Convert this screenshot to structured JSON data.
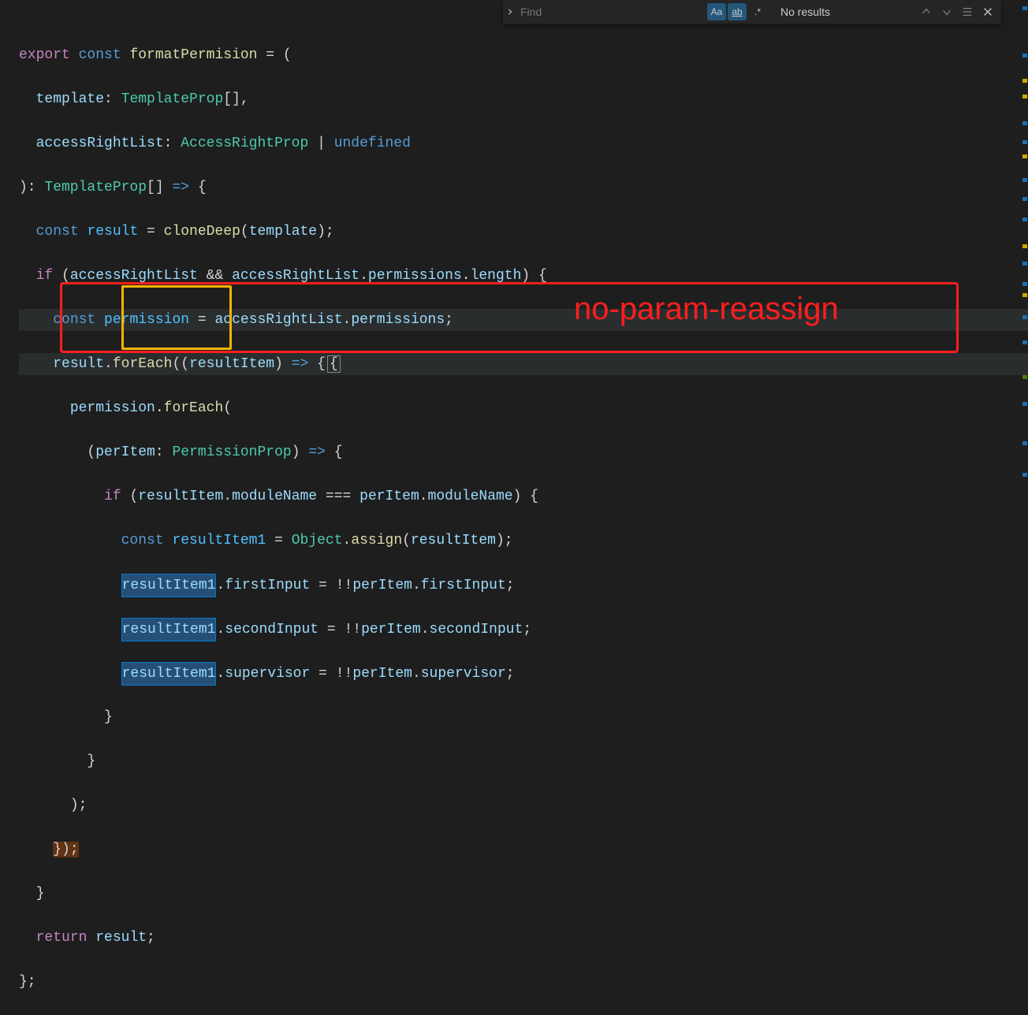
{
  "find": {
    "placeholder": "Find",
    "results_label": "No results"
  },
  "annotation_label": "no-param-reassign",
  "code": {
    "l1": {
      "kw": "export",
      "kw2": "const",
      "fn": "formatPermision",
      "s": " = ("
    },
    "l2": {
      "var": "template",
      "s1": ": ",
      "typ": "TemplateProp",
      "s2": "[],"
    },
    "l3": {
      "var": "accessRightList",
      "s1": ": ",
      "typ": "AccessRightProp",
      "s2": " | ",
      "kw2": "undefined"
    },
    "l4": {
      "s1": "): ",
      "typ": "TemplateProp",
      "s2": "[] ",
      "kw2": "=>",
      "s3": " {"
    },
    "l5": {
      "kw2": "const",
      "var": "result",
      "s1": " = ",
      "fn": "cloneDeep",
      "s2": "(",
      "var2": "template",
      "s3": ");"
    },
    "l6": {
      "kw": "if",
      "s1": " (",
      "var": "accessRightList",
      "s2": " && ",
      "var2": "accessRightList",
      "s3": ".",
      "var3": "permissions",
      "s4": ".",
      "var4": "length",
      "s5": ") {"
    },
    "l7": {
      "kw2": "const",
      "var": "permission",
      "s1": " = ",
      "var2": "accessRightList",
      "s2": ".",
      "var3": "permissions",
      "s3": ";"
    },
    "l8": {
      "var": "result",
      "s1": ".",
      "fn": "forEach",
      "s2": "((",
      "var2": "resultItem",
      "s3": ") ",
      "kw2": "=>",
      "s4": " {"
    },
    "l9": {
      "var": "permission",
      "s1": ".",
      "fn": "forEach",
      "s2": "("
    },
    "l10": {
      "s1": "(",
      "var": "perItem",
      "s2": ": ",
      "typ": "PermissionProp",
      "s3": ") ",
      "kw2": "=>",
      "s4": " {"
    },
    "l11": {
      "kw": "if",
      "s1": " (",
      "var": "resultItem",
      "s2": ".",
      "var2": "moduleName",
      "s3": " === ",
      "var3": "perItem",
      "s4": ".",
      "var4": "moduleName",
      "s5": ") {"
    },
    "l12": {
      "kw2": "const",
      "var": "resultItem1",
      "s1": " = ",
      "cnst": "Object",
      "s2": ".",
      "fn": "assign",
      "s3": "(",
      "var2": "resultItem",
      "s4": ");"
    },
    "l13": {
      "var": "resultItem1",
      "s1": ".",
      "var2": "firstInput",
      "s2": " = !!",
      "var3": "perItem",
      "s3": ".",
      "var4": "firstInput",
      "s4": ";"
    },
    "l14": {
      "var": "resultItem1",
      "s1": ".",
      "var2": "secondInput",
      "s2": " = !!",
      "var3": "perItem",
      "s3": ".",
      "var4": "secondInput",
      "s4": ";"
    },
    "l15": {
      "var": "resultItem1",
      "s1": ".",
      "var2": "supervisor",
      "s2": " = !!",
      "var3": "perItem",
      "s3": ".",
      "var4": "supervisor",
      "s4": ";"
    },
    "l16": {
      "s": "}"
    },
    "l17": {
      "s": "}"
    },
    "l18": {
      "s": ");"
    },
    "l19": {
      "s": "});"
    },
    "l20": {
      "s": "}"
    },
    "l21": {
      "kw": "return",
      "var": "result",
      "s": ";"
    },
    "l22": {
      "s": "};"
    }
  }
}
